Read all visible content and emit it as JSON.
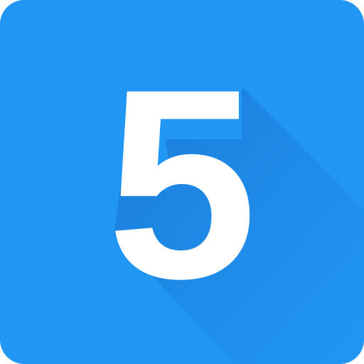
{
  "icon": {
    "digit": "5",
    "colors": {
      "background": "#2196F3",
      "digit": "#FFFFFF",
      "long_shadow": "#1976D2"
    }
  }
}
